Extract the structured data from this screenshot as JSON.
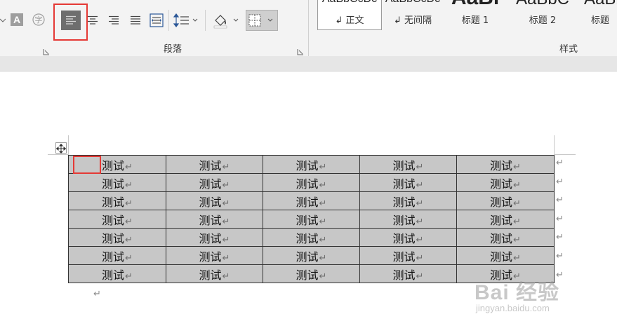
{
  "ribbon": {
    "paragraph_group_label": "段落",
    "styles_group_label": "样式",
    "styles": [
      {
        "preview": "AaBbCcDc",
        "name": "↲ 正文"
      },
      {
        "preview": "AaBbCcDc",
        "name": "↲ 无间隔"
      },
      {
        "preview": "AaBl",
        "name": "标题 1"
      },
      {
        "preview": "AaBbC",
        "name": "标题 2"
      },
      {
        "preview": "AaBb",
        "name": "标题"
      }
    ]
  },
  "document": {
    "cell_text": "测试",
    "cell_mark": "↵",
    "row_end_mark": "↵",
    "paragraph_mark": "↵",
    "rows": [
      [
        "测试",
        "测试",
        "测试",
        "测试",
        "测试"
      ],
      [
        "测试",
        "测试",
        "测试",
        "测试",
        "测试"
      ],
      [
        "测试",
        "测试",
        "测试",
        "测试",
        "测试"
      ],
      [
        "测试",
        "测试",
        "测试",
        "测试",
        "测试"
      ],
      [
        "测试",
        "测试",
        "测试",
        "测试",
        "测试"
      ],
      [
        "测试",
        "测试",
        "测试",
        "测试",
        "测试"
      ],
      [
        "测试",
        "测试",
        "测试",
        "测试",
        "测试"
      ]
    ]
  },
  "watermark": {
    "main": "Bai 经验",
    "sub": "jingyan.baidu.com"
  },
  "colors": {
    "highlight": "#e53935",
    "cell_shading": "#c7c7c7",
    "ribbon_bg": "#f3f3f3"
  }
}
